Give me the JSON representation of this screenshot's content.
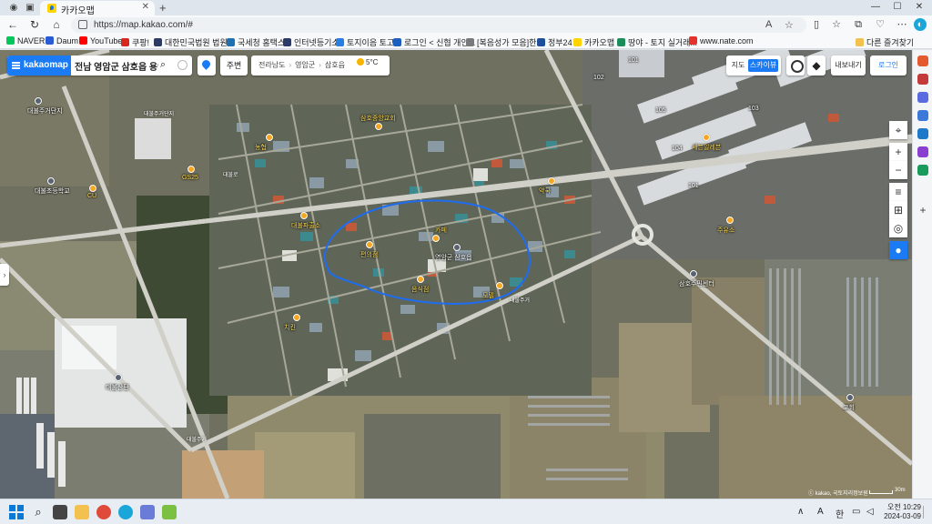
{
  "browser": {
    "tab_title": "카카오맵",
    "url": "https://map.kakao.com/#",
    "read_aloud_label": "A",
    "window_controls": {
      "minimize": "—",
      "maximize": "☐",
      "close": "✕"
    }
  },
  "bookmarks": [
    {
      "label": "NAVER",
      "color": "#03c75a"
    },
    {
      "label": "Daum",
      "color": "#2a5bd7"
    },
    {
      "label": "YouTube",
      "color": "#ff0000"
    },
    {
      "label": "쿠팡!",
      "color": "#d5271e"
    },
    {
      "label": "대한민국법원 법원...",
      "color": "#2b3a67"
    },
    {
      "label": "국세청 홈택스",
      "color": "#1f6fb3"
    },
    {
      "label": "인터넷등기소",
      "color": "#2b3a67"
    },
    {
      "label": "토지이음 토고",
      "color": "#2a7de1"
    },
    {
      "label": "로그인 < 신협 개인...",
      "color": "#1d5fbf"
    },
    {
      "label": "[복음성가 모음]한...",
      "color": "#7a7a7a"
    },
    {
      "label": "정부24",
      "color": "#1f4e9b"
    },
    {
      "label": "카카오맵",
      "color": "#ffd400"
    },
    {
      "label": "땅야 - 토지 실거래...",
      "color": "#1c8c5a"
    },
    {
      "label": "www.nate.com",
      "color": "#e4312b"
    }
  ],
  "other_bookmarks": "다른 즐겨찾기",
  "kakaomap": {
    "logo": "kakaomap",
    "search_query": "전남 영암군 삼호읍 용앙리",
    "nearby_label": "주변",
    "breadcrumbs": [
      "전라남도",
      "영암군",
      "삼호읍"
    ],
    "weather": "5°C",
    "maptype": {
      "map": "지도",
      "satellite": "스카이뷰",
      "active": "스카이뷰"
    },
    "share_label": "내보내기",
    "login_label": "로그인",
    "copyright": "ⓒ kakao, 국토지리정보원",
    "scale_label": "30m"
  },
  "map_labels": {
    "roads": [
      "대불주거단지",
      "대불로",
      "대불주거",
      "대불주거"
    ],
    "pois": [
      {
        "label": "대불주거단지",
        "kind": "b"
      },
      {
        "label": "대불초등학교",
        "kind": "b"
      },
      {
        "label": "GS25",
        "kind": "y"
      },
      {
        "label": "CU",
        "kind": "y"
      },
      {
        "label": "농협",
        "kind": "y"
      },
      {
        "label": "삼호중앙교회",
        "kind": "y"
      },
      {
        "label": "대불파출소",
        "kind": "y"
      },
      {
        "label": "편의점",
        "kind": "y"
      },
      {
        "label": "영암군 삼호읍",
        "kind": "b"
      },
      {
        "label": "카페",
        "kind": "y"
      },
      {
        "label": "음식점",
        "kind": "y"
      },
      {
        "label": "모텔",
        "kind": "y"
      },
      {
        "label": "치킨",
        "kind": "y"
      },
      {
        "label": "약국",
        "kind": "y"
      },
      {
        "label": "세븐일레븐",
        "kind": "y"
      },
      {
        "label": "주유소",
        "kind": "y"
      },
      {
        "label": "삼호주민센터",
        "kind": "b"
      },
      {
        "label": "대불산단",
        "kind": "b"
      },
      {
        "label": "교회",
        "kind": "b"
      }
    ],
    "apartment_numbers": [
      "101",
      "102",
      "103",
      "104",
      "105",
      "101"
    ]
  },
  "taskbar": {
    "ime_mode": "A",
    "lang": "한",
    "time": "오전 10:29",
    "date": "2024-03-09"
  }
}
